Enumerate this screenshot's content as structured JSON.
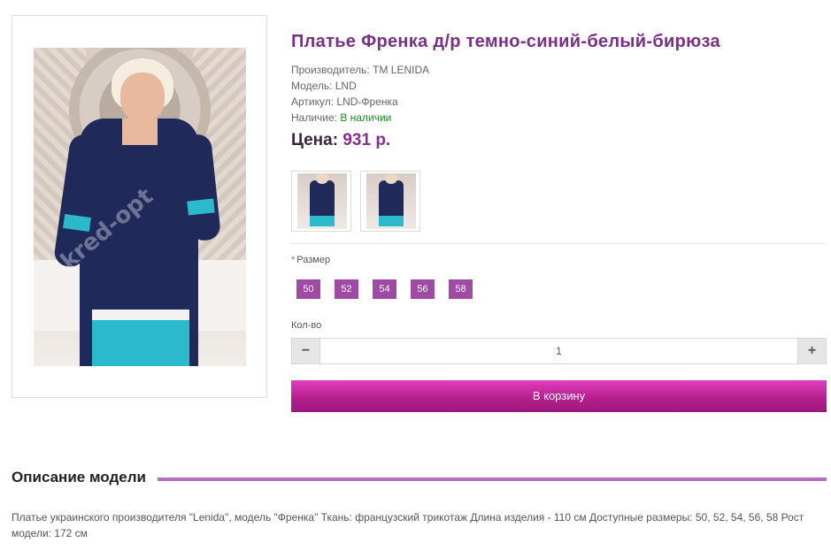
{
  "product": {
    "title": "Платье Френка д/р темно-синий-белый-бирюза",
    "manufacturer_label": "Производитель:",
    "manufacturer": "TM LENIDA",
    "model_label": "Модель:",
    "model": "LND",
    "sku_label": "Артикул:",
    "sku": "LND-Френка",
    "availability_label": "Наличие:",
    "availability": "В наличии",
    "price_label": "Цена:",
    "price": "931 р.",
    "watermark": "kred-opt"
  },
  "options": {
    "size_label": "Размер",
    "required_mark": "*",
    "sizes": [
      "50",
      "52",
      "54",
      "56",
      "58"
    ]
  },
  "quantity": {
    "label": "Кол-во",
    "value": "1",
    "minus": "−",
    "plus": "+"
  },
  "cart": {
    "button_label": "В корзину"
  },
  "description": {
    "title": "Описание модели",
    "text": "Платье украинского производителя \"Lenida\", модель \"Френка\" Ткань: французский трикотаж Длина изделия - 110 см Доступные размеры: 50, 52, 54, 56, 58 Рост модели: 172 см"
  },
  "colors": {
    "title": "#7a2f86",
    "price": "#8a2e8e",
    "size_button": "#a04aa6",
    "cart_button": "#b7208f",
    "in_stock": "#1a8a1a",
    "accent_line": "#b76ec0"
  }
}
